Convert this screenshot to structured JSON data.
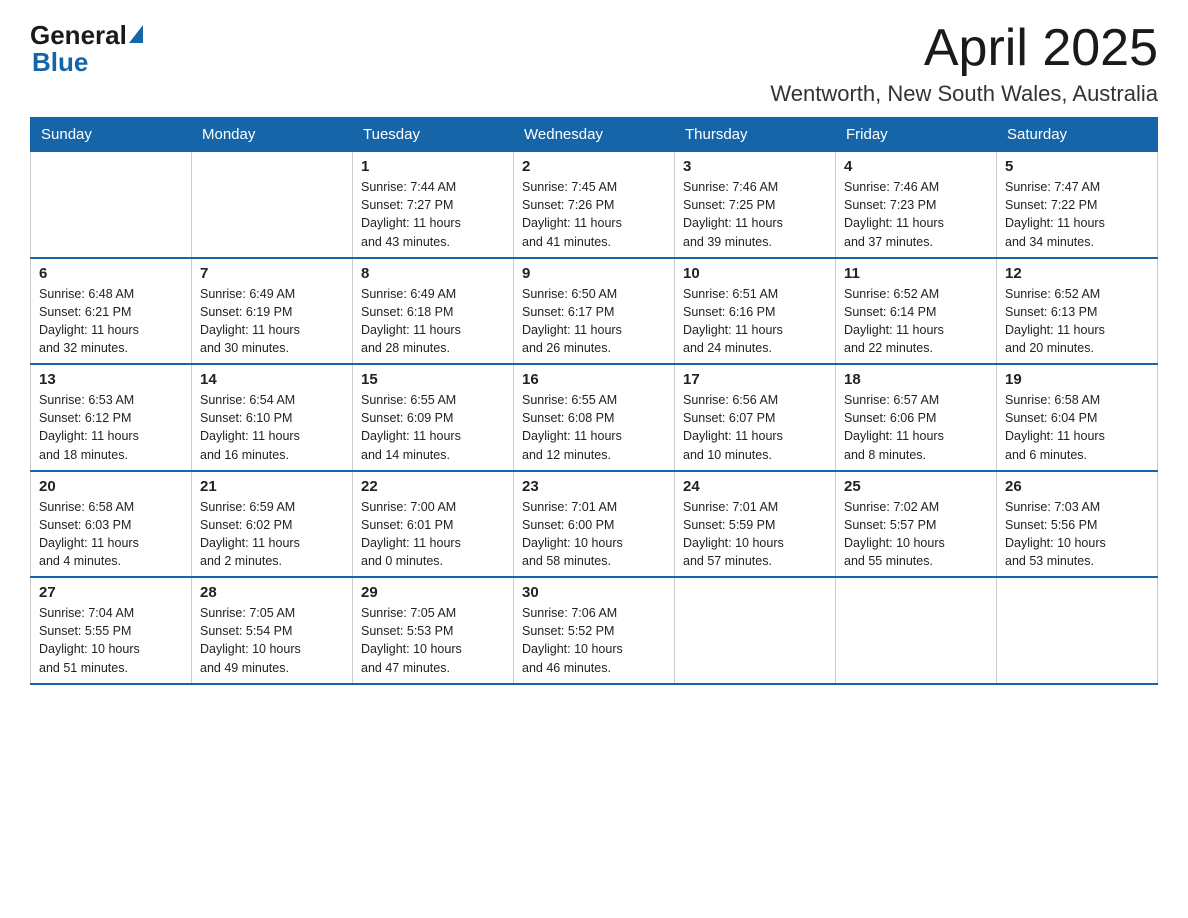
{
  "header": {
    "logo_general": "General",
    "logo_blue": "Blue",
    "month_title": "April 2025",
    "location": "Wentworth, New South Wales, Australia"
  },
  "days_of_week": [
    "Sunday",
    "Monday",
    "Tuesday",
    "Wednesday",
    "Thursday",
    "Friday",
    "Saturday"
  ],
  "weeks": [
    [
      {
        "day": "",
        "info": ""
      },
      {
        "day": "",
        "info": ""
      },
      {
        "day": "1",
        "info": "Sunrise: 7:44 AM\nSunset: 7:27 PM\nDaylight: 11 hours\nand 43 minutes."
      },
      {
        "day": "2",
        "info": "Sunrise: 7:45 AM\nSunset: 7:26 PM\nDaylight: 11 hours\nand 41 minutes."
      },
      {
        "day": "3",
        "info": "Sunrise: 7:46 AM\nSunset: 7:25 PM\nDaylight: 11 hours\nand 39 minutes."
      },
      {
        "day": "4",
        "info": "Sunrise: 7:46 AM\nSunset: 7:23 PM\nDaylight: 11 hours\nand 37 minutes."
      },
      {
        "day": "5",
        "info": "Sunrise: 7:47 AM\nSunset: 7:22 PM\nDaylight: 11 hours\nand 34 minutes."
      }
    ],
    [
      {
        "day": "6",
        "info": "Sunrise: 6:48 AM\nSunset: 6:21 PM\nDaylight: 11 hours\nand 32 minutes."
      },
      {
        "day": "7",
        "info": "Sunrise: 6:49 AM\nSunset: 6:19 PM\nDaylight: 11 hours\nand 30 minutes."
      },
      {
        "day": "8",
        "info": "Sunrise: 6:49 AM\nSunset: 6:18 PM\nDaylight: 11 hours\nand 28 minutes."
      },
      {
        "day": "9",
        "info": "Sunrise: 6:50 AM\nSunset: 6:17 PM\nDaylight: 11 hours\nand 26 minutes."
      },
      {
        "day": "10",
        "info": "Sunrise: 6:51 AM\nSunset: 6:16 PM\nDaylight: 11 hours\nand 24 minutes."
      },
      {
        "day": "11",
        "info": "Sunrise: 6:52 AM\nSunset: 6:14 PM\nDaylight: 11 hours\nand 22 minutes."
      },
      {
        "day": "12",
        "info": "Sunrise: 6:52 AM\nSunset: 6:13 PM\nDaylight: 11 hours\nand 20 minutes."
      }
    ],
    [
      {
        "day": "13",
        "info": "Sunrise: 6:53 AM\nSunset: 6:12 PM\nDaylight: 11 hours\nand 18 minutes."
      },
      {
        "day": "14",
        "info": "Sunrise: 6:54 AM\nSunset: 6:10 PM\nDaylight: 11 hours\nand 16 minutes."
      },
      {
        "day": "15",
        "info": "Sunrise: 6:55 AM\nSunset: 6:09 PM\nDaylight: 11 hours\nand 14 minutes."
      },
      {
        "day": "16",
        "info": "Sunrise: 6:55 AM\nSunset: 6:08 PM\nDaylight: 11 hours\nand 12 minutes."
      },
      {
        "day": "17",
        "info": "Sunrise: 6:56 AM\nSunset: 6:07 PM\nDaylight: 11 hours\nand 10 minutes."
      },
      {
        "day": "18",
        "info": "Sunrise: 6:57 AM\nSunset: 6:06 PM\nDaylight: 11 hours\nand 8 minutes."
      },
      {
        "day": "19",
        "info": "Sunrise: 6:58 AM\nSunset: 6:04 PM\nDaylight: 11 hours\nand 6 minutes."
      }
    ],
    [
      {
        "day": "20",
        "info": "Sunrise: 6:58 AM\nSunset: 6:03 PM\nDaylight: 11 hours\nand 4 minutes."
      },
      {
        "day": "21",
        "info": "Sunrise: 6:59 AM\nSunset: 6:02 PM\nDaylight: 11 hours\nand 2 minutes."
      },
      {
        "day": "22",
        "info": "Sunrise: 7:00 AM\nSunset: 6:01 PM\nDaylight: 11 hours\nand 0 minutes."
      },
      {
        "day": "23",
        "info": "Sunrise: 7:01 AM\nSunset: 6:00 PM\nDaylight: 10 hours\nand 58 minutes."
      },
      {
        "day": "24",
        "info": "Sunrise: 7:01 AM\nSunset: 5:59 PM\nDaylight: 10 hours\nand 57 minutes."
      },
      {
        "day": "25",
        "info": "Sunrise: 7:02 AM\nSunset: 5:57 PM\nDaylight: 10 hours\nand 55 minutes."
      },
      {
        "day": "26",
        "info": "Sunrise: 7:03 AM\nSunset: 5:56 PM\nDaylight: 10 hours\nand 53 minutes."
      }
    ],
    [
      {
        "day": "27",
        "info": "Sunrise: 7:04 AM\nSunset: 5:55 PM\nDaylight: 10 hours\nand 51 minutes."
      },
      {
        "day": "28",
        "info": "Sunrise: 7:05 AM\nSunset: 5:54 PM\nDaylight: 10 hours\nand 49 minutes."
      },
      {
        "day": "29",
        "info": "Sunrise: 7:05 AM\nSunset: 5:53 PM\nDaylight: 10 hours\nand 47 minutes."
      },
      {
        "day": "30",
        "info": "Sunrise: 7:06 AM\nSunset: 5:52 PM\nDaylight: 10 hours\nand 46 minutes."
      },
      {
        "day": "",
        "info": ""
      },
      {
        "day": "",
        "info": ""
      },
      {
        "day": "",
        "info": ""
      }
    ]
  ]
}
